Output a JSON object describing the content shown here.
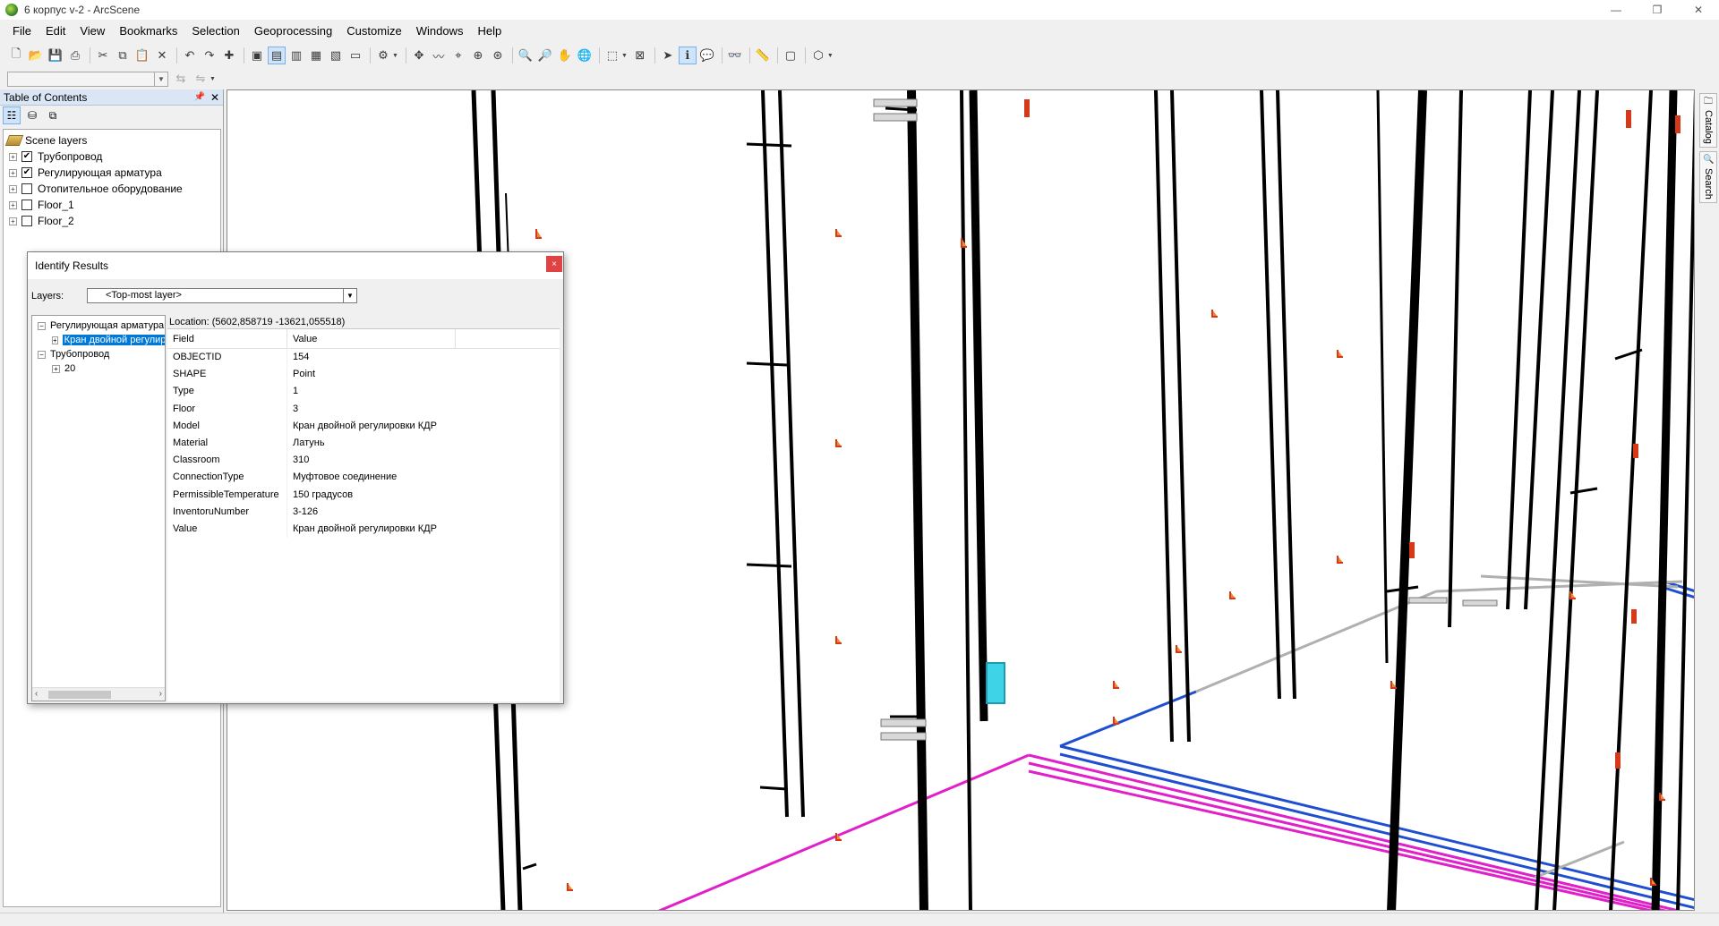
{
  "window": {
    "title": "6 корпус v-2 - ArcScene",
    "controls": [
      "—",
      "❐",
      "✕"
    ]
  },
  "menu": [
    "File",
    "Edit",
    "View",
    "Bookmarks",
    "Selection",
    "Geoprocessing",
    "Customize",
    "Windows",
    "Help"
  ],
  "toc": {
    "title": "Table of Contents",
    "root": "Scene layers",
    "layers": [
      {
        "name": "Трубопровод",
        "checked": true
      },
      {
        "name": "Регулирующая арматура",
        "checked": true
      },
      {
        "name": "Отопительное оборудование",
        "checked": false
      },
      {
        "name": "Floor_1",
        "checked": false
      },
      {
        "name": "Floor_2",
        "checked": false
      }
    ]
  },
  "dock": {
    "catalog": "Catalog",
    "search": "Search"
  },
  "identify": {
    "title": "Identify Results",
    "close": "×",
    "layers_label": "Layers:",
    "layers_value": "<Top-most layer>",
    "tree": {
      "layer1": "Регулирующая арматура",
      "layer1_child": "Кран двойной регулировки КДР",
      "layer2": "Трубопровод",
      "layer2_child": "20"
    },
    "location": "Location: (5602,858719 -13621,055518)",
    "columns": {
      "field": "Field",
      "value": "Value"
    },
    "rows": [
      {
        "field": "OBJECTID",
        "value": "154"
      },
      {
        "field": "SHAPE",
        "value": "Point"
      },
      {
        "field": "Type",
        "value": "1"
      },
      {
        "field": "Floor",
        "value": "3"
      },
      {
        "field": "Model",
        "value": "Кран двойной регулировки КДР"
      },
      {
        "field": "Material",
        "value": "Латунь"
      },
      {
        "field": "Classroom",
        "value": "310"
      },
      {
        "field": "ConnectionType",
        "value": "Муфтовое соединение"
      },
      {
        "field": "PermissibleTemperature",
        "value": "150 градусов"
      },
      {
        "field": "InventoruNumber",
        "value": "3-126"
      },
      {
        "field": "Value",
        "value": "Кран двойной регулировки КДР"
      }
    ]
  },
  "colors": {
    "magenta_pipe": "#e020c8",
    "blue_pipe": "#1f4fd0",
    "black_pipe": "#000000",
    "valve_red": "#d43a1a",
    "valve_orange": "#f08a30",
    "selection_cyan": "#3fd3e8"
  }
}
